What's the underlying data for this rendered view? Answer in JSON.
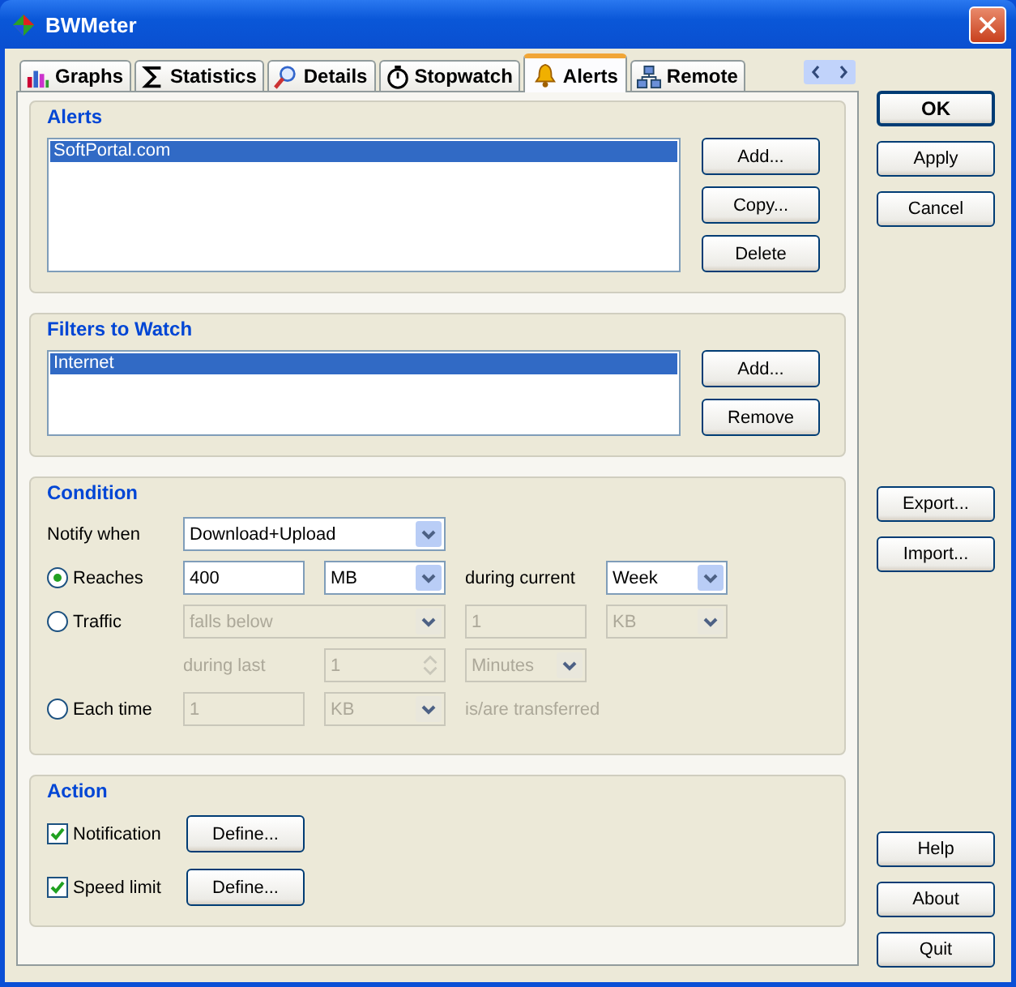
{
  "window": {
    "title": "BWMeter"
  },
  "tabs": [
    {
      "label": "Graphs",
      "selected": false
    },
    {
      "label": "Statistics",
      "selected": false
    },
    {
      "label": "Details",
      "selected": false
    },
    {
      "label": "Stopwatch",
      "selected": false
    },
    {
      "label": "Alerts",
      "selected": true
    },
    {
      "label": "Remote",
      "selected": false
    }
  ],
  "alerts": {
    "title": "Alerts",
    "items": [
      {
        "label": "SoftPortal.com",
        "selected": true
      }
    ],
    "buttons": [
      "Add...",
      "Copy...",
      "Delete"
    ]
  },
  "filters": {
    "title": "Filters to Watch",
    "items": [
      {
        "label": "Internet",
        "selected": true
      }
    ],
    "buttons": [
      "Add...",
      "Remove"
    ]
  },
  "condition": {
    "title": "Condition",
    "notify_label": "Notify when",
    "notify_value": "Download+Upload",
    "reaches": {
      "label": "Reaches",
      "selected": true,
      "disabled": false,
      "amount": "400",
      "unit": "MB",
      "during_label": "during current",
      "period": "Week"
    },
    "traffic": {
      "label": "Traffic",
      "selected": false,
      "disabled": true,
      "comparison": "falls below",
      "amount": "1",
      "unit": "KB",
      "during_label": "during last",
      "duration": "1",
      "duration_unit": "Minutes"
    },
    "each_time": {
      "label": "Each time",
      "selected": false,
      "disabled": true,
      "amount": "1",
      "unit": "KB",
      "suffix": "is/are transferred"
    }
  },
  "action": {
    "title": "Action",
    "items": [
      {
        "label": "Notification",
        "checked": true,
        "button": "Define..."
      },
      {
        "label": "Speed limit",
        "checked": true,
        "button": "Define..."
      }
    ]
  },
  "side_buttons": {
    "top": [
      {
        "label": "OK",
        "default": true
      },
      {
        "label": "Apply",
        "default": false
      },
      {
        "label": "Cancel",
        "default": false
      }
    ],
    "middle": [
      {
        "label": "Export...",
        "default": false
      },
      {
        "label": "Import...",
        "default": false
      }
    ],
    "bottom": [
      {
        "label": "Help",
        "default": false
      },
      {
        "label": "About",
        "default": false
      },
      {
        "label": "Quit",
        "default": false
      }
    ]
  }
}
